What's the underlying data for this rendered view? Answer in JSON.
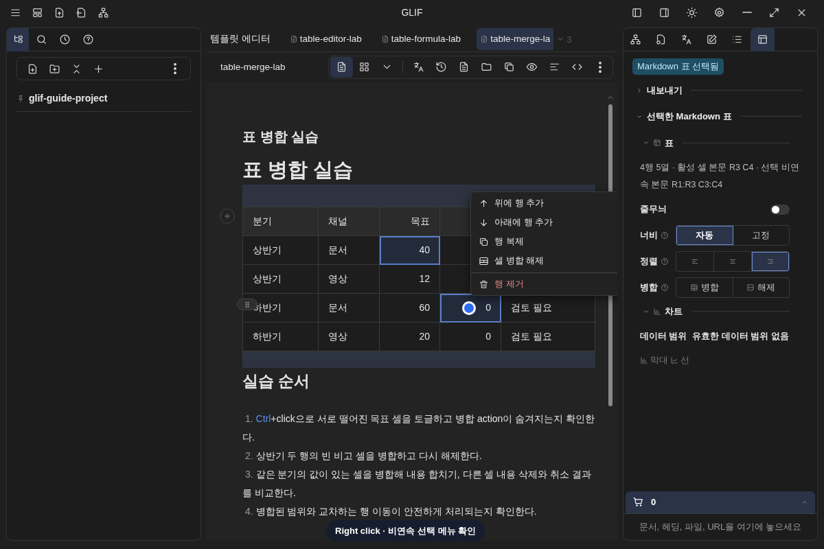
{
  "window": {
    "title": "GLIF"
  },
  "left_panel": {
    "tabs": [
      {
        "selected": true
      },
      {
        "selected": false
      },
      {
        "selected": false
      },
      {
        "selected": false
      }
    ],
    "project": "glif-guide-project"
  },
  "editor_tabs": [
    {
      "label": "템플릿 에디터",
      "kind": "plain",
      "selected": false
    },
    {
      "label": "table-editor-lab",
      "kind": "doc",
      "selected": false
    },
    {
      "label": "table-formula-lab",
      "kind": "doc",
      "selected": false
    },
    {
      "label": "table-merge-la",
      "kind": "doc",
      "selected": true
    }
  ],
  "overflow_count": "3",
  "document": {
    "name": "table-merge-lab",
    "view_modes": [
      {
        "selected": true
      },
      {
        "selected": false
      }
    ],
    "title": "표 병합 실습",
    "heading": "표 병합 실습",
    "table": {
      "columns": [
        "분기",
        "채널",
        "목표"
      ],
      "rows": [
        {
          "cells": [
            {
              "text": "상반기",
              "selected": false
            },
            {
              "text": "문서",
              "selected": false
            },
            {
              "text": "40",
              "selected": true
            }
          ]
        },
        {
          "cells": [
            {
              "text": "상반기",
              "selected": false
            },
            {
              "text": "영상",
              "selected": false
            },
            {
              "text": "12",
              "selected": false
            }
          ]
        },
        {
          "cells": [
            {
              "text": "하반기",
              "selected": false
            },
            {
              "text": "문서",
              "selected": false
            },
            {
              "text": "60",
              "selected": false
            },
            {
              "text": "0",
              "selected": true
            },
            {
              "text": "검토 필요",
              "selected": false
            }
          ]
        },
        {
          "cells": [
            {
              "text": "하반기",
              "selected": false
            },
            {
              "text": "영상",
              "selected": false
            },
            {
              "text": "20",
              "selected": false
            },
            {
              "text": "0",
              "selected": false
            },
            {
              "text": "검토 필요",
              "selected": false
            }
          ]
        }
      ]
    },
    "steps_heading": "실습 순서",
    "steps": [
      {
        "number": "1.",
        "key": "Ctrl",
        "text": "+click으로 서로 떨어진 목표 셀을 토글하고 병합 action이 숨겨지는지 확인한다."
      },
      {
        "number": "2.",
        "text": "상반기 두 행의 빈 비고 셀을 병합하고 다시 해제한다."
      },
      {
        "number": "3.",
        "text": "같은 분기의 값이 있는 셀을 병합해 내용 합치기, 다른 셀 내용 삭제와 취소 결과를 비교한다."
      },
      {
        "number": "4.",
        "text": "병합된 범위와 교차하는 행 이동이 안전하게 처리되는지 확인한다."
      }
    ]
  },
  "context_menu": [
    {
      "label": "위에 행 추가",
      "kind": "normal"
    },
    {
      "label": "아래에 행 추가",
      "kind": "normal"
    },
    {
      "label": "행 복제",
      "kind": "normal"
    },
    {
      "label": "셀 병합 해제",
      "kind": "normal"
    },
    {
      "label": "행 제거",
      "kind": "danger"
    }
  ],
  "toast": "Right click · 비연속 선택 메뉴 확인",
  "right_panel": {
    "tabs": [
      {
        "selected": false
      },
      {
        "selected": false
      },
      {
        "selected": false
      },
      {
        "selected": false
      },
      {
        "selected": false
      },
      {
        "selected": true
      }
    ],
    "badge": "Markdown 표 선택됨",
    "sections": [
      {
        "title": "내보내기",
        "expanded": false
      },
      {
        "title": "선택한 Markdown 표",
        "expanded": true
      }
    ],
    "table_section": {
      "title": "표",
      "expanded": true,
      "info": "4행 5열 · 활성 셀 본문 R3 C4 · 선택 비연속 본문 R1:R3 C3:C4",
      "stripes": {
        "label": "줄무늬",
        "on": false
      },
      "width": {
        "label": "너비",
        "options": [
          {
            "label": "자동",
            "selected": true
          },
          {
            "label": "고정",
            "selected": false
          }
        ]
      },
      "align": {
        "label": "정렬",
        "options": [
          {
            "selected": false
          },
          {
            "selected": false
          },
          {
            "selected": true
          }
        ]
      },
      "merge": {
        "label": "병합",
        "options": [
          {
            "label": "병합"
          },
          {
            "label": "해제"
          }
        ]
      }
    },
    "chart_section": {
      "title": "차트",
      "expanded": true,
      "range_label": "데이터 범위",
      "range_value": "유효한 데이터 범위 없음",
      "types": [
        {
          "label": "막대",
          "disabled": true
        },
        {
          "label": "선",
          "disabled": true
        }
      ]
    },
    "cart": {
      "count": "0",
      "expanded": false
    },
    "dropzone": "문서, 헤딩, 파일, URL을 여기에 놓으세요"
  }
}
